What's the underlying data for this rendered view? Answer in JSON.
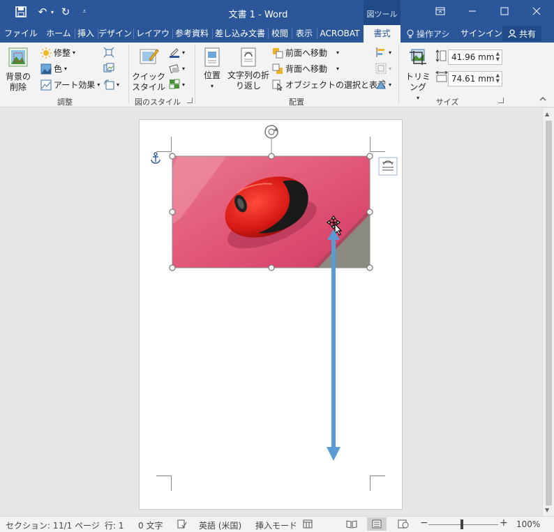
{
  "window": {
    "title": "文書 1 - Word",
    "contextual_tab_group": "図ツール",
    "accent_color": "#2b579a"
  },
  "quick_access": {
    "icons": [
      "save-icon",
      "undo-icon",
      "redo-icon",
      "customize-icon"
    ]
  },
  "tabs": [
    {
      "label": "ファイル"
    },
    {
      "label": "ホーム"
    },
    {
      "label": "挿入"
    },
    {
      "label": "デザイン"
    },
    {
      "label": "レイアウト"
    },
    {
      "label": "参考資料"
    },
    {
      "label": "差し込み文書"
    },
    {
      "label": "校閲"
    },
    {
      "label": "表示"
    },
    {
      "label": "ACROBAT"
    },
    {
      "label": "書式"
    }
  ],
  "active_tab": "書式",
  "tell_me": "操作アシ",
  "signin": "サインイン",
  "share": "共有",
  "ribbon": {
    "adjust": {
      "remove_bg_line1": "背景の",
      "remove_bg_line2": "削除",
      "corrections": "修整",
      "color": "色",
      "artistic": "アート効果",
      "label": "調整"
    },
    "styles": {
      "quick_line1": "クイック",
      "quick_line2": "スタイル",
      "label": "図のスタイル"
    },
    "arrange": {
      "position": "位置",
      "wrap_line1": "文字列の折",
      "wrap_line2": "り返し",
      "bring_forward": "前面へ移動",
      "send_backward": "背面へ移動",
      "selection_pane": "オブジェクトの選択と表示",
      "label": "配置"
    },
    "size": {
      "crop": "トリミング",
      "height": "41.96 mm",
      "width": "74.61 mm",
      "label": "サイズ"
    }
  },
  "statusbar": {
    "section": "セクション: 1",
    "page": "1/1 ページ",
    "line": "行: 1",
    "chars": "0 文字",
    "language": "英語 (米国)",
    "mode": "挿入モード",
    "zoom": "100%",
    "zoom_level": 1.0
  }
}
